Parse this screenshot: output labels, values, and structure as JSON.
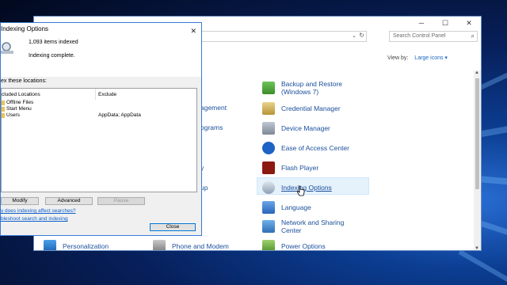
{
  "control_panel": {
    "search_placeholder": "Search Control Panel",
    "view_by_label": "View by:",
    "view_by_value": "Large icons ▾",
    "items": [
      {
        "label": "Backup and Restore\n(Windows 7)",
        "icon": "backup-icon"
      },
      {
        "label": "Credential Manager",
        "icon": "credential-icon"
      },
      {
        "label": "Device Manager",
        "icon": "device-icon"
      },
      {
        "label": "Ease of Access Center",
        "icon": "ease-icon"
      },
      {
        "label": "Flash Player",
        "icon": "flash-icon"
      },
      {
        "label": "Indexing Options",
        "icon": "indexing-icon"
      },
      {
        "label": "Language",
        "icon": "language-icon"
      },
      {
        "label": "Network and Sharing\nCenter",
        "icon": "network-icon"
      },
      {
        "label": "Power Options",
        "icon": "power-icon"
      }
    ],
    "partial_items": [
      "agement",
      "ograms",
      "y",
      "up"
    ],
    "bottom_items": [
      "Personalization",
      "Phone and Modem"
    ]
  },
  "dialog": {
    "title": "Indexing Options",
    "items_indexed": "1,093 items indexed",
    "status": "Indexing complete.",
    "locations_lead": "ex these locations:",
    "col_included": "cluded Locations",
    "col_exclude": "Exclude",
    "rows": [
      {
        "name": "Offline Files",
        "exclude": ""
      },
      {
        "name": "Start Menu",
        "exclude": ""
      },
      {
        "name": "Users",
        "exclude": "AppData; AppData"
      }
    ],
    "modify": "Modify",
    "advanced": "Advanced",
    "pause": "Pause",
    "link1": "y does indexing affect searches?",
    "link2": "bleshoot search and indexing",
    "close": "Close"
  }
}
